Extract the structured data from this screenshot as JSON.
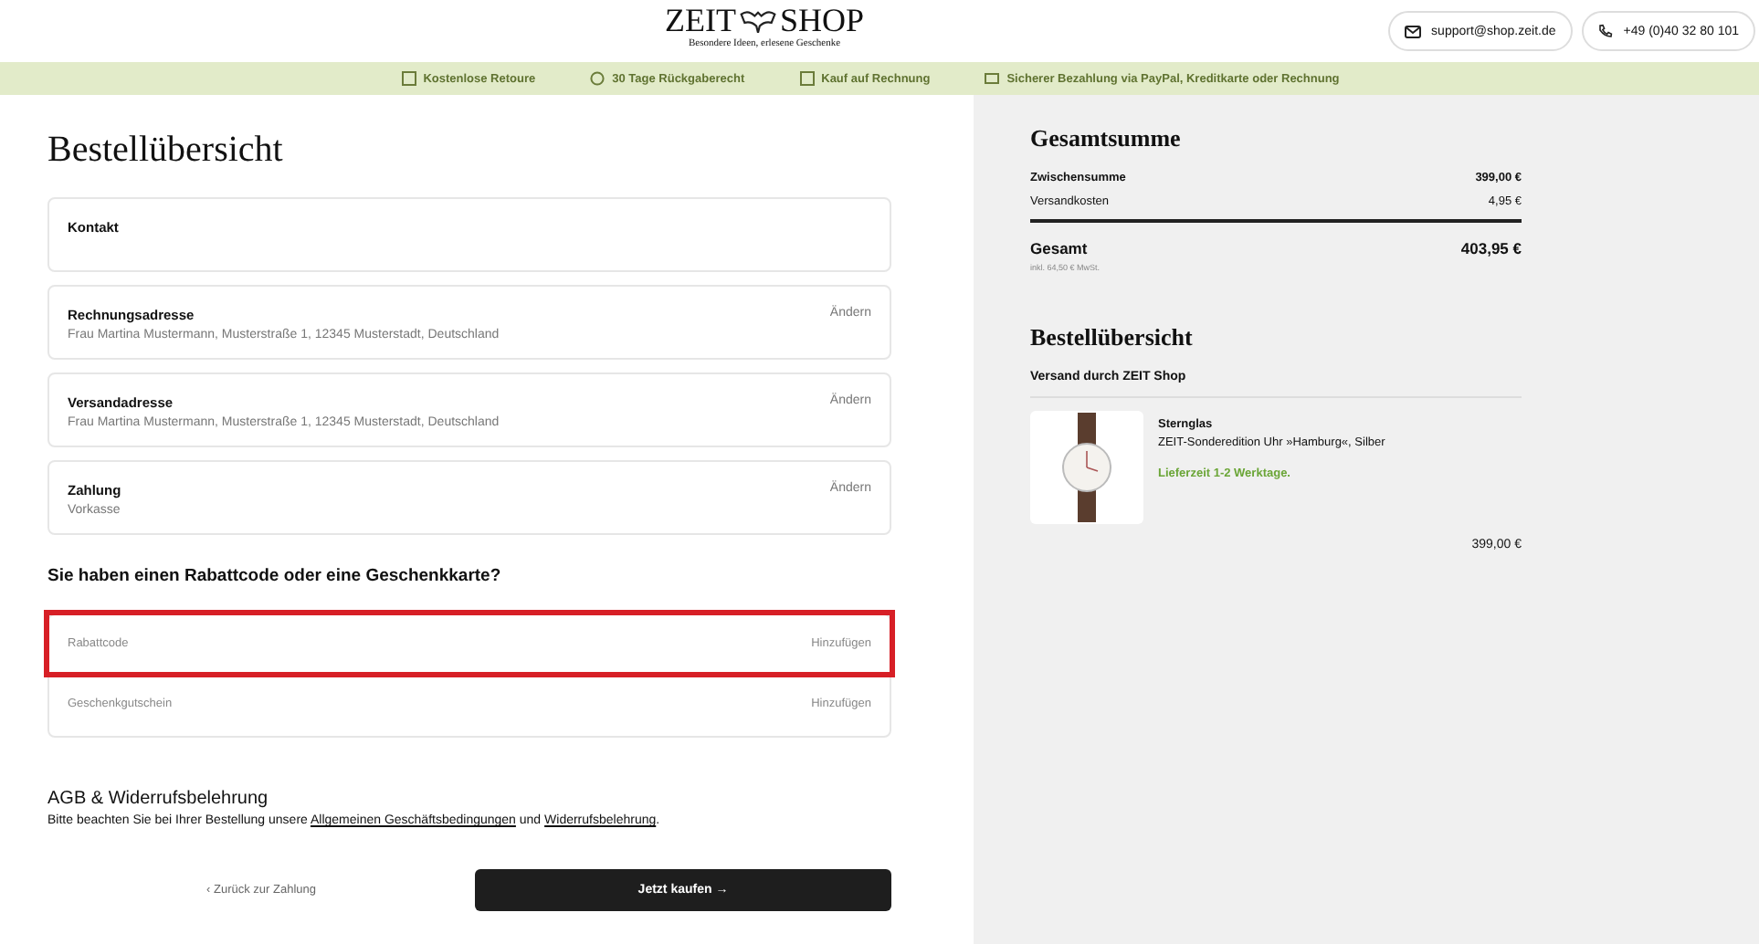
{
  "header": {
    "logo_left": "ZEIT",
    "logo_right": "SHOP",
    "tagline": "Besondere Ideen, erlesene Geschenke",
    "contacts": [
      {
        "kind": "mail",
        "label": "support@shop.zeit.de"
      },
      {
        "kind": "phone",
        "label": "+49 (0)40 32 80 101"
      }
    ]
  },
  "benefits": [
    {
      "kind": "box",
      "label": "Kostenlose Retoure"
    },
    {
      "kind": "cycle",
      "label": "30 Tage Rückgaberecht"
    },
    {
      "kind": "invoice",
      "label": "Kauf auf Rechnung"
    },
    {
      "kind": "card",
      "label": "Sicherer Bezahlung via PayPal, Kreditkarte oder Rechnung"
    }
  ],
  "main": {
    "title": "Bestellübersicht",
    "sections": [
      {
        "title": "Kontakt"
      },
      {
        "title": "Rechnungsadresse",
        "value": "Frau Martina Mustermann, Musterstraße 1, 12345 Musterstadt, Deutschland",
        "action": "Ändern"
      },
      {
        "title": "Versandadresse",
        "value": "Frau Martina Mustermann, Musterstraße 1, 12345 Musterstadt, Deutschland",
        "action": "Ändern"
      },
      {
        "title": "Zahlung",
        "value": "Vorkasse",
        "action": "Ändern"
      }
    ],
    "discount_heading": "Sie haben einen Rabattcode oder eine Geschenkkarte?",
    "discount_rows": [
      {
        "label": "Rabattcode",
        "action": "Hinzufügen",
        "highlighted": true
      },
      {
        "label": "Geschenkgutschein",
        "action": "Hinzufügen",
        "highlighted": false
      }
    ],
    "terms_heading": "AGB & Widerrufsbelehrung",
    "terms_text": [
      "Bitte beachten Sie bei Ihrer Bestellung unsere ",
      "Allgemeinen Geschäftsbedingungen",
      " und ",
      "Widerrufsbelehrung",
      "."
    ],
    "back_link": "‹ Zurück zur Zahlung",
    "buy_button": "Jetzt kaufen →"
  },
  "summary": {
    "title": "Gesamtsumme",
    "rows": [
      {
        "label": "Zwischensumme",
        "value": "399,00 €"
      },
      {
        "label": "Versandkosten",
        "value": "4,95 €"
      }
    ],
    "total_label": "Gesamt",
    "total_value": "403,95 €",
    "tax_note": "inkl. 64,50 € MwSt.",
    "order_title": "Bestellübersicht",
    "shipping_by": "Versand durch ZEIT Shop",
    "items": [
      {
        "brand": "Sternglas",
        "name": "ZEIT-Sonderedition Uhr »Hamburg«, Silber",
        "delivery": "Lieferzeit 1-2 Werktage.",
        "price": "399,00 €"
      }
    ]
  }
}
